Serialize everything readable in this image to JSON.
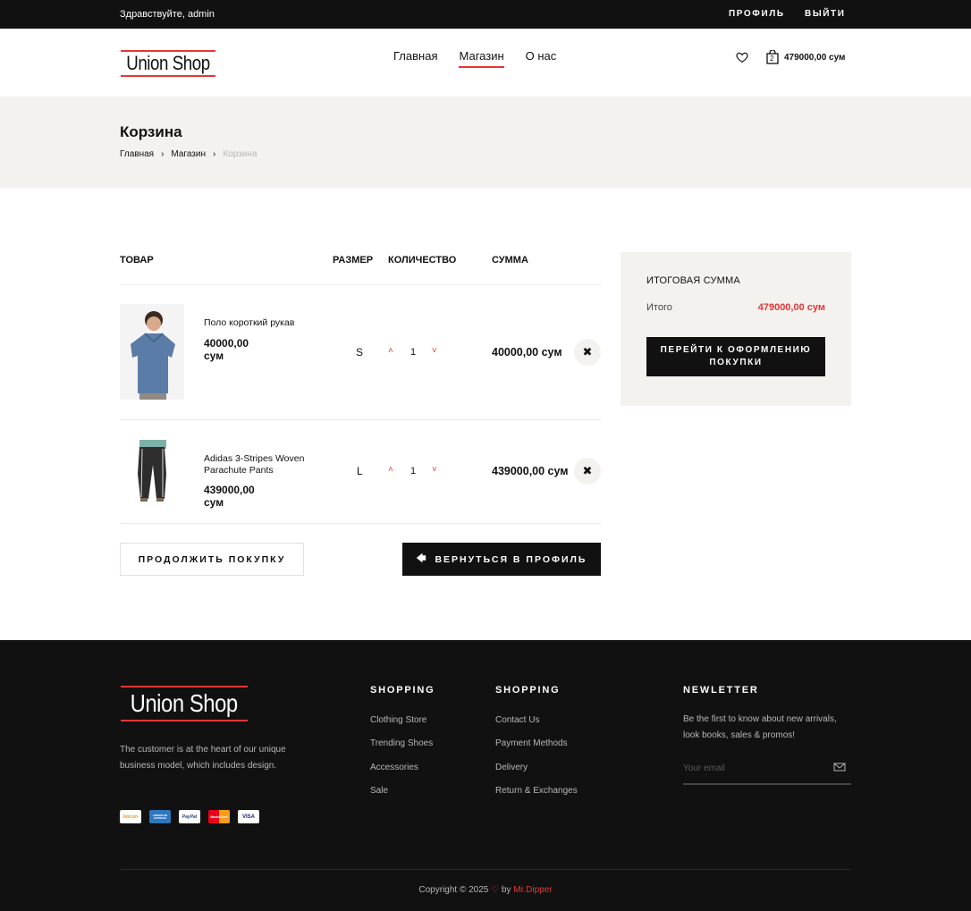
{
  "topbar": {
    "greeting": "Здравствуйте, admin",
    "profile": "ПРОФИЛЬ",
    "logout": "ВЫЙТИ"
  },
  "header": {
    "logo": "Union Shop",
    "nav": [
      "Главная",
      "Магазин",
      "О нас"
    ],
    "active_nav": "Магазин",
    "cart_count": "2",
    "cart_total": "479000,00 сум"
  },
  "page": {
    "title": "Корзина",
    "breadcrumb": [
      "Главная",
      "Магазин",
      "Корзина"
    ]
  },
  "table": {
    "headers": {
      "product": "ТОВАР",
      "size": "РАЗМЕР",
      "qty": "КОЛИЧЕСТВО",
      "sum": "СУММА"
    },
    "rows": [
      {
        "name": "Поло короткий рукав",
        "price": "40000,00 сум",
        "size": "S",
        "qty": "1",
        "sum": "40000,00 сум"
      },
      {
        "name": "Adidas 3-Stripes Woven Parachute Pants",
        "price": "439000,00 сум",
        "size": "L",
        "qty": "1",
        "sum": "439000,00 сум"
      }
    ]
  },
  "buttons": {
    "continue": "ПРОДОЛЖИТЬ ПОКУПКУ",
    "back_profile": "ВЕРНУТЬСЯ В ПРОФИЛЬ",
    "checkout": "ПЕРЕЙТИ К ОФОРМЛЕНИЮ ПОКУПКИ"
  },
  "summary": {
    "title": "ИТОГОВАЯ СУММА",
    "total_label": "Итого",
    "total_value": "479000,00 сум"
  },
  "footer": {
    "logo": "Union Shop",
    "about": "The customer is at the heart of our unique business model, which includes design.",
    "payments": [
      "bitcoin",
      "AMERICAN EXPRESS",
      "PayPal",
      "MasterCard",
      "VISA"
    ],
    "col1": {
      "title": "SHOPPING",
      "items": [
        "Clothing Store",
        "Trending Shoes",
        "Accessories",
        "Sale"
      ]
    },
    "col2": {
      "title": "SHOPPING",
      "items": [
        "Contact Us",
        "Payment Methods",
        "Delivery",
        "Return & Exchanges"
      ]
    },
    "newsletter": {
      "title": "NEWLETTER",
      "text": "Be the first to know about new arrivals, look books, sales & promos!",
      "placeholder": "Your email"
    },
    "copyright": "Copyright © 2025",
    "by": "by",
    "author": "Mr.Dipper"
  },
  "colors": {
    "accent": "#e53637",
    "dark": "#111111",
    "light_bg": "#f3f2ee"
  }
}
